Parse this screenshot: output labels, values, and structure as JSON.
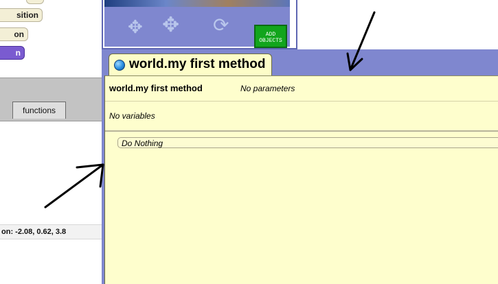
{
  "left_panel": {
    "property_pills": [
      "sition",
      "on",
      "n"
    ],
    "tabs": {
      "functions_label": "functions"
    },
    "status_text": "on: -2.08, 0.62, 3.8"
  },
  "world_controls": {
    "add_objects_line1": "ADD",
    "add_objects_line2": "OBJECTS",
    "nav_icons": [
      "move-arrows-icon",
      "move-arrows-icon",
      "rotate-icon"
    ]
  },
  "editor": {
    "tab_title": "world.my first method",
    "method_name": "world.my first method",
    "params_label": "No parameters",
    "variables_label": "No variables",
    "body_placeholder": "Do Nothing"
  },
  "colors": {
    "editor_background": "#fefecd",
    "frame_blue": "#7f87cf",
    "add_objects_green": "#12a51c",
    "pill_purple": "#7a5bd0"
  }
}
